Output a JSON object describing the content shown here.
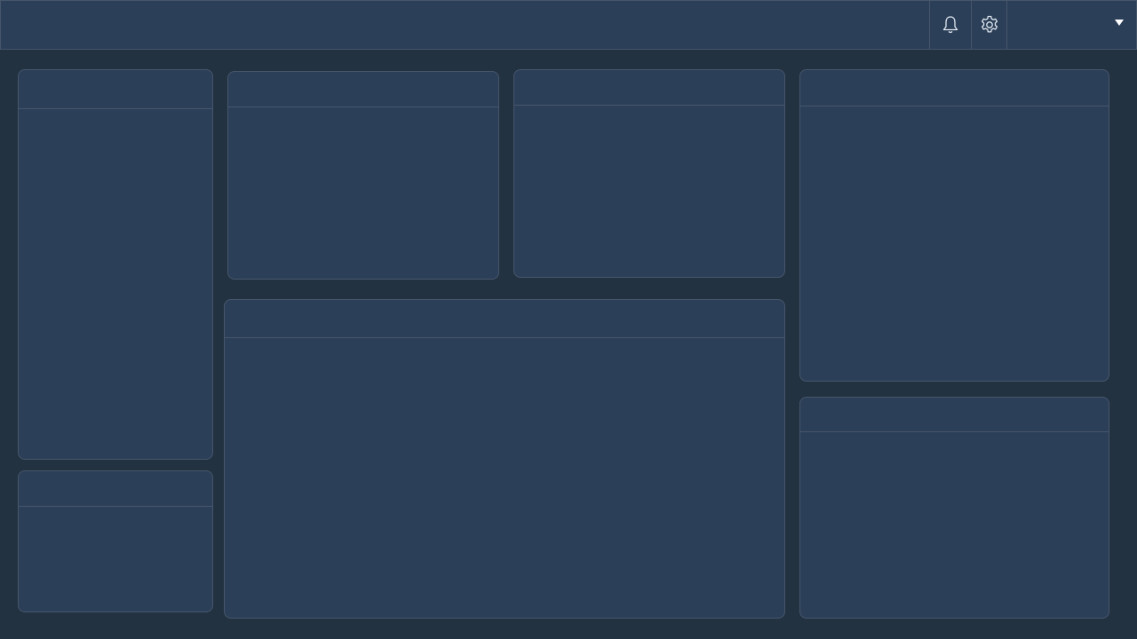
{
  "header": {
    "icons": {
      "notifications": "bell-icon",
      "settings": "gear-icon",
      "user_menu_caret": "caret-down-icon"
    },
    "user_name": ""
  },
  "panels": {
    "left_top": {
      "title": ""
    },
    "left_bottom": {
      "title": ""
    },
    "center_left": {
      "title": ""
    },
    "center_right": {
      "title": ""
    },
    "center_wide": {
      "title": ""
    },
    "right_top": {
      "title": ""
    },
    "right_bottom": {
      "title": ""
    }
  },
  "colors": {
    "background": "#233241",
    "panel": "#2c3f58",
    "border": "#46566b"
  }
}
